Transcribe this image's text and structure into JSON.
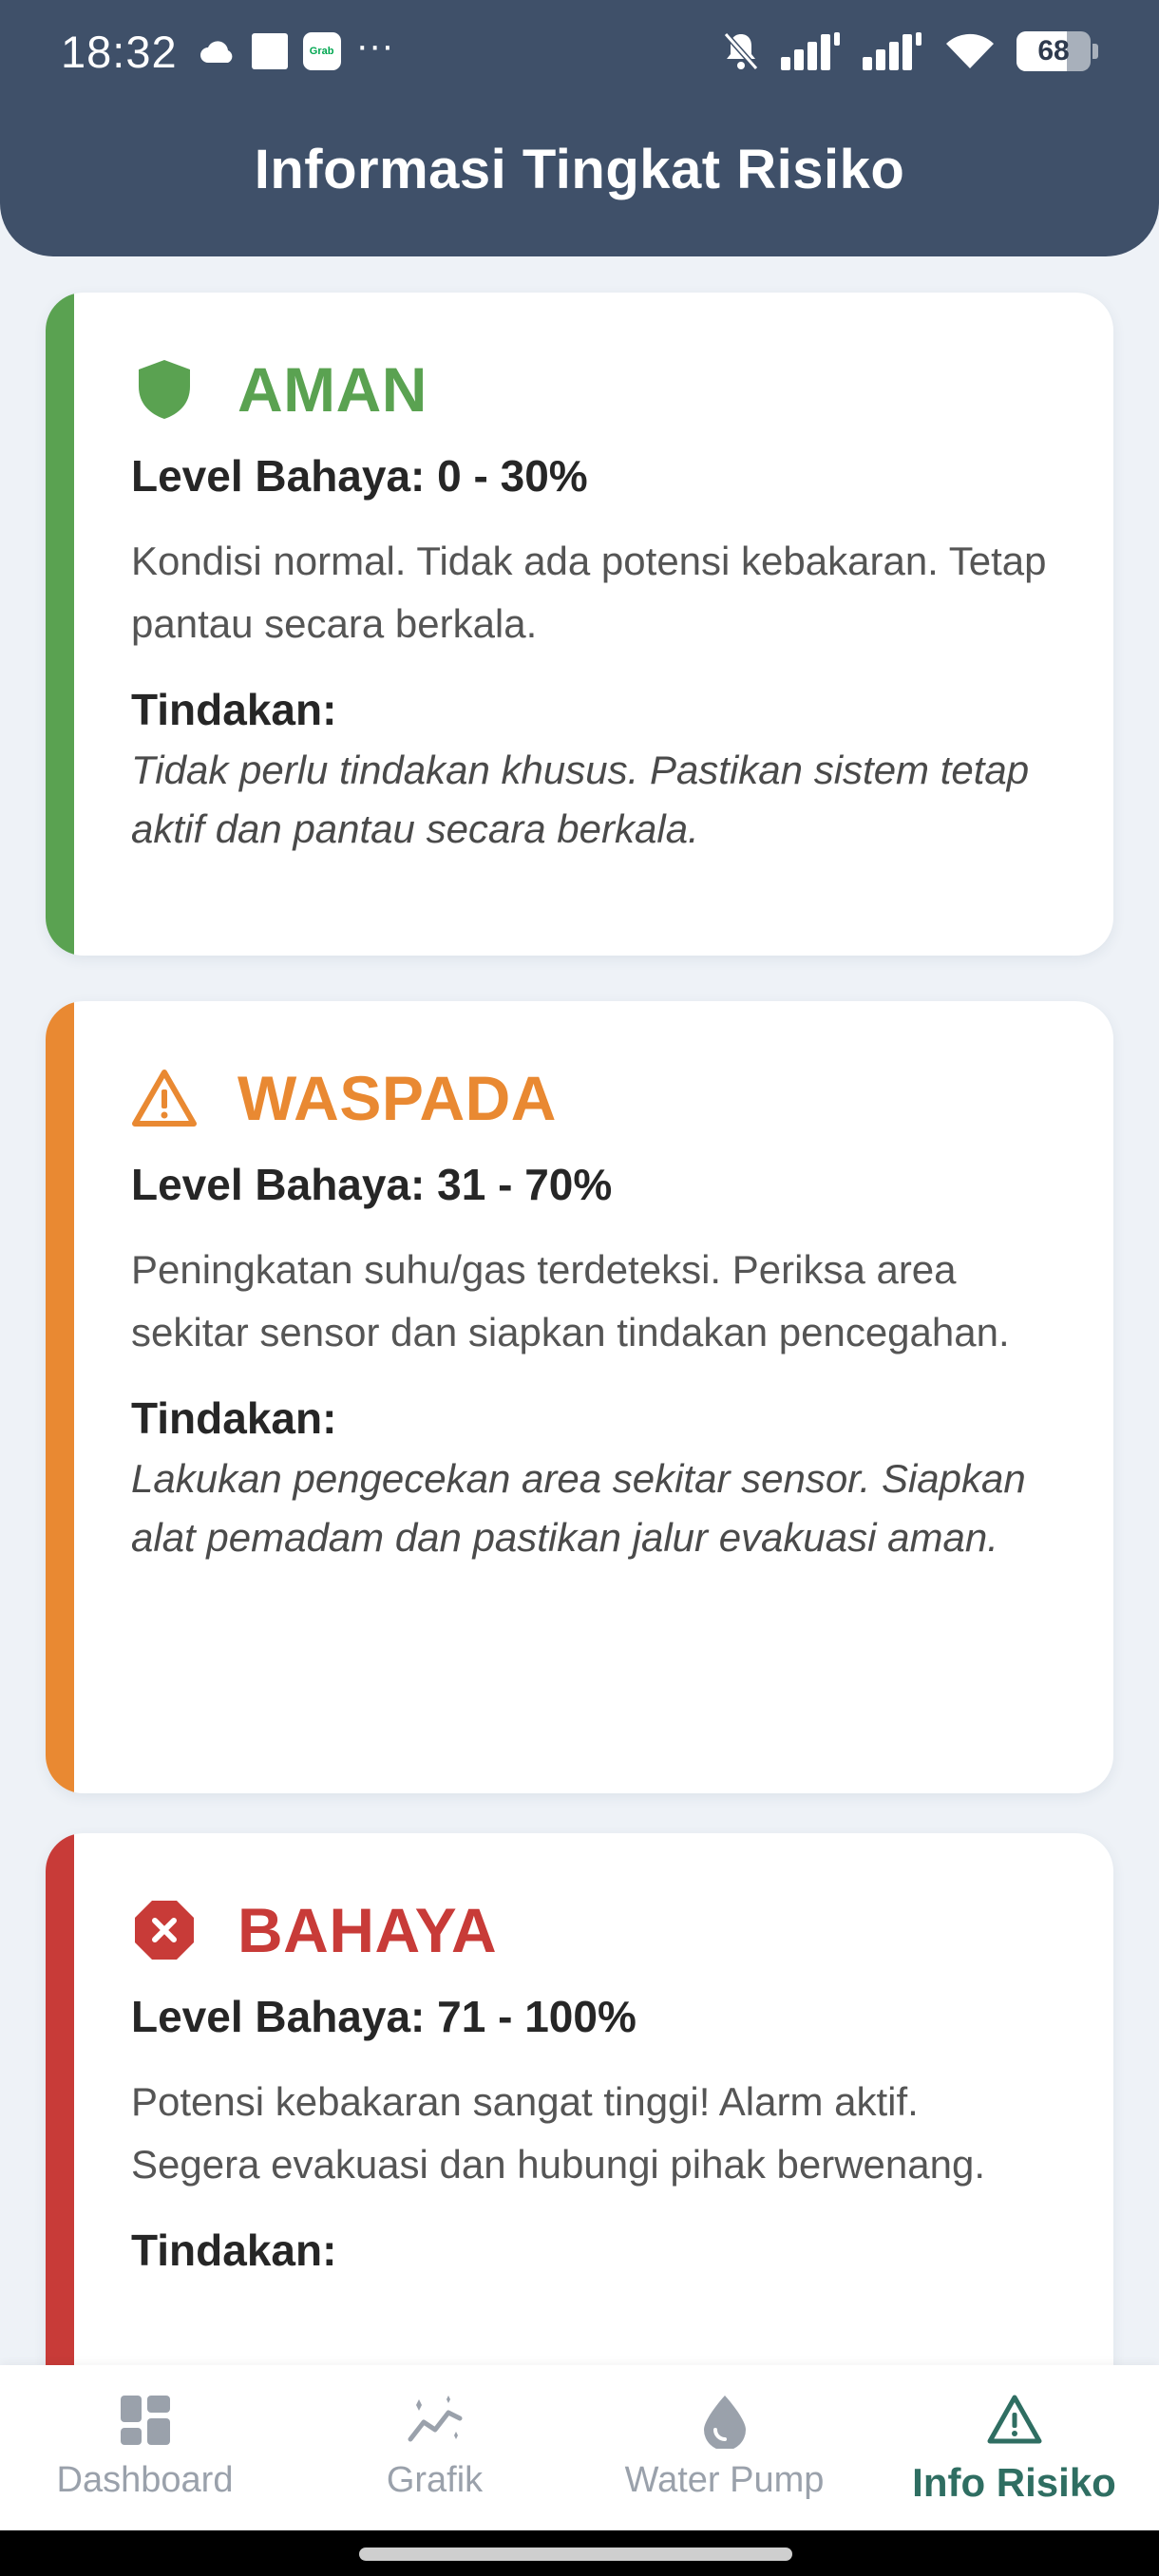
{
  "status_bar": {
    "time": "18:32",
    "grab_label": "Grab",
    "battery": "68",
    "battery_level": 0.68
  },
  "header": {
    "title": "Informasi Tingkat Risiko"
  },
  "cards": [
    {
      "title": "AMAN",
      "level": "Level Bahaya: 0 - 30%",
      "description": "Kondisi normal. Tidak ada potensi kebakaran. Tetap pantau secara berkala.",
      "action_label": "Tindakan:",
      "action": "Tidak perlu tindakan khusus. Pastikan sistem tetap aktif dan pantau secara berkala.",
      "color": "#5aa251",
      "icon": "shield-icon"
    },
    {
      "title": "WASPADA",
      "level": "Level Bahaya: 31 - 70%",
      "description": "Peningkatan suhu/gas terdeteksi. Periksa area sekitar sensor dan siapkan tindakan pencegahan.",
      "action_label": "Tindakan:",
      "action": "Lakukan pengecekan area sekitar sensor. Siapkan alat pemadam dan pastikan jalur evakuasi aman.",
      "color": "#e98932",
      "icon": "warning-icon"
    },
    {
      "title": "BAHAYA",
      "level": "Level Bahaya: 71 - 100%",
      "description": "Potensi kebakaran sangat tinggi! Alarm aktif. Segera evakuasi dan hubungi pihak berwenang.",
      "action_label": "Tindakan:",
      "color": "#c83b38",
      "icon": "danger-octagon-icon"
    }
  ],
  "nav": {
    "items": [
      {
        "label": "Dashboard",
        "icon": "dashboard-icon"
      },
      {
        "label": "Grafik",
        "icon": "chart-icon"
      },
      {
        "label": "Water Pump",
        "icon": "water-drop-icon"
      },
      {
        "label": "Info Risiko",
        "icon": "warning-icon",
        "active": true
      }
    ],
    "active_color": "#2f6e62",
    "inactive_color": "#9aa1ab"
  },
  "colors": {
    "header_bg": "#3f5069",
    "page_bg": "#eef2f7"
  }
}
